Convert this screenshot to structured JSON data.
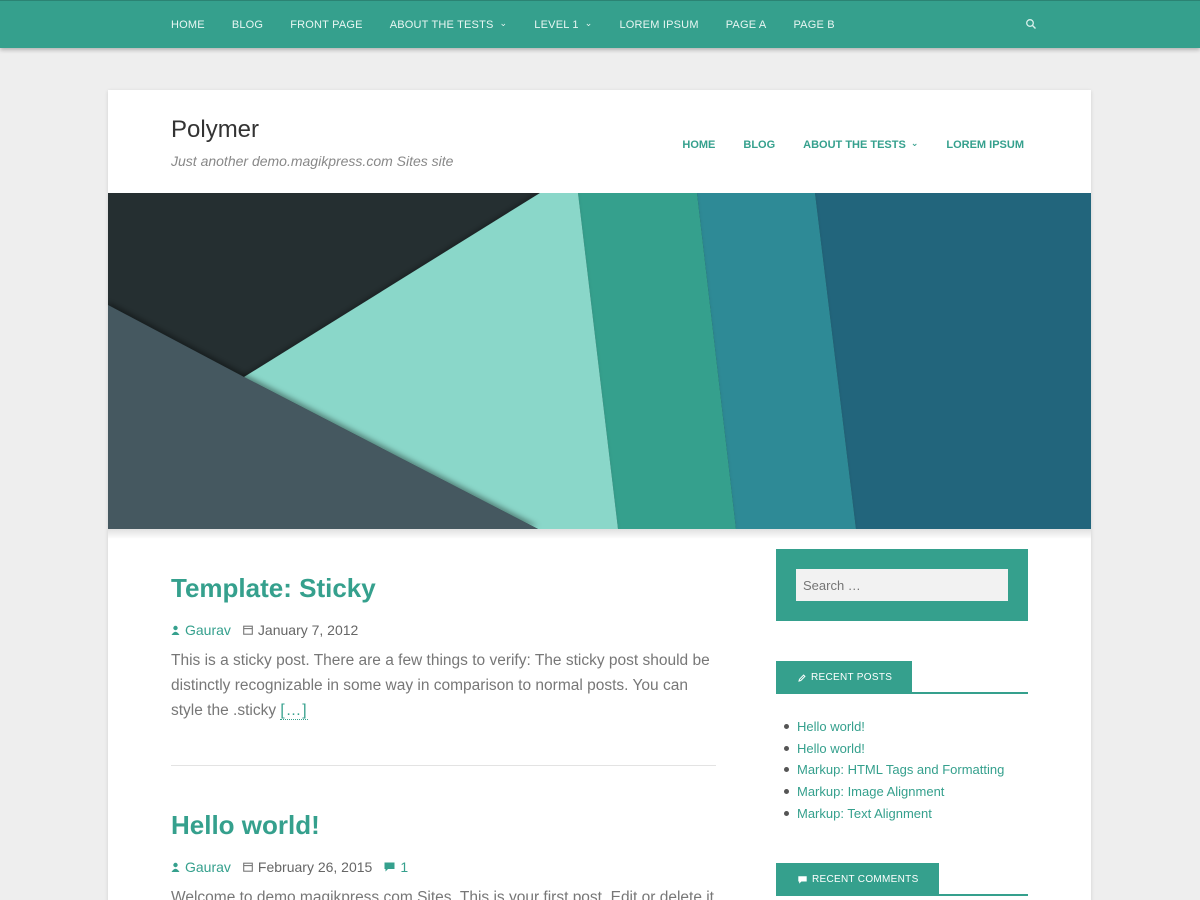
{
  "colors": {
    "accent": "#35a08d",
    "background": "#eeeeee",
    "card": "#ffffff"
  },
  "topnav": {
    "items": [
      {
        "label": "HOME",
        "dropdown": false
      },
      {
        "label": "BLOG",
        "dropdown": false
      },
      {
        "label": "FRONT PAGE",
        "dropdown": false
      },
      {
        "label": "ABOUT THE TESTS",
        "dropdown": true
      },
      {
        "label": "LEVEL 1",
        "dropdown": true
      },
      {
        "label": "LOREM IPSUM",
        "dropdown": false
      },
      {
        "label": "PAGE A",
        "dropdown": false
      },
      {
        "label": "PAGE B",
        "dropdown": false
      }
    ],
    "search_icon": "search-icon"
  },
  "site": {
    "title": "Polymer",
    "description": "Just another demo.magikpress.com Sites site"
  },
  "mainnav": {
    "items": [
      {
        "label": "HOME",
        "dropdown": false
      },
      {
        "label": "BLOG",
        "dropdown": false
      },
      {
        "label": "ABOUT THE TESTS",
        "dropdown": true
      },
      {
        "label": "LOREM IPSUM",
        "dropdown": false
      }
    ]
  },
  "posts": [
    {
      "title": "Template: Sticky",
      "author": "Gaurav",
      "date": "January 7, 2012",
      "comments": "",
      "excerpt": "This is a sticky post. There are a few things to verify: The sticky post should be distinctly recognizable in some way in comparison to normal posts. You can style the .sticky",
      "more": "[…]"
    },
    {
      "title": "Hello world!",
      "author": "Gaurav",
      "date": "February 26, 2015",
      "comments": "1",
      "excerpt": "Welcome to demo.magikpress.com Sites. This is your first post. Edit or delete it",
      "more": ""
    }
  ],
  "sidebar": {
    "search": {
      "placeholder": "Search …"
    },
    "recent_posts": {
      "title": "RECENT POSTS",
      "items": [
        "Hello world!",
        "Hello world!",
        "Markup: HTML Tags and Formatting",
        "Markup: Image Alignment",
        "Markup: Text Alignment"
      ]
    },
    "recent_comments": {
      "title": "RECENT COMMENTS"
    }
  }
}
